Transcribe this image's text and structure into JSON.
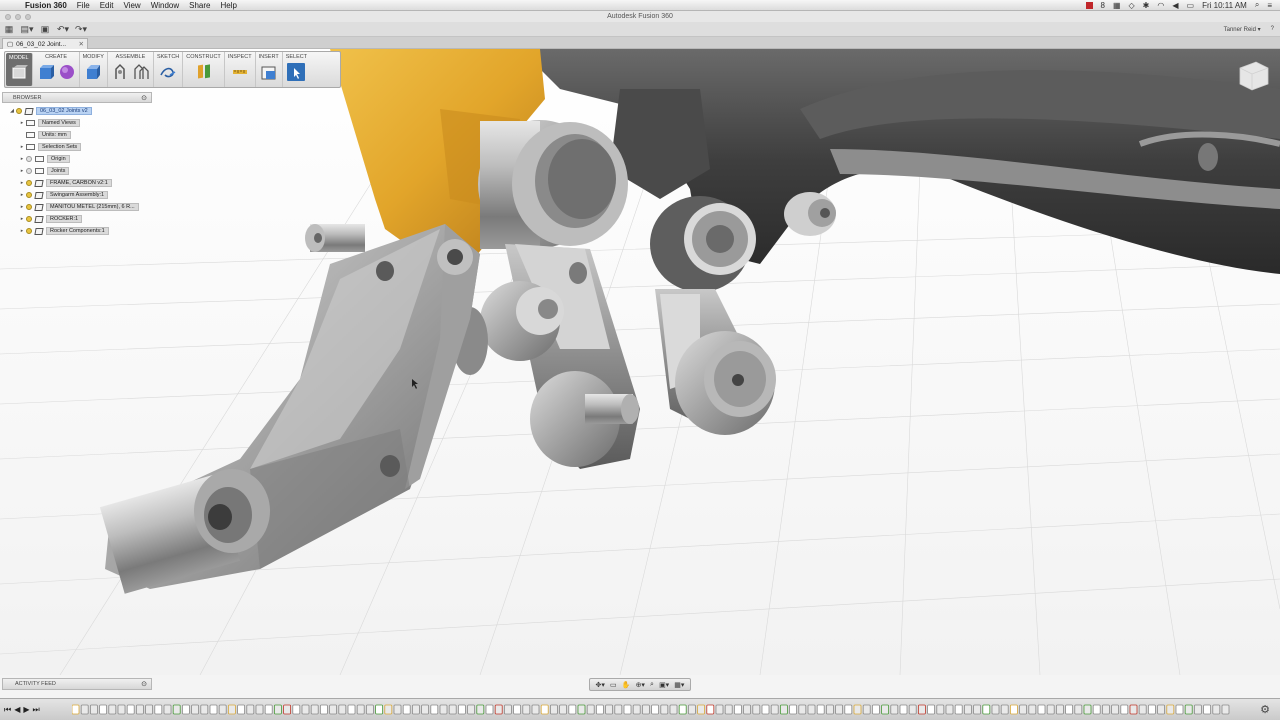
{
  "menubar": {
    "apple": "",
    "app_name": "Fusion 360",
    "items": [
      "File",
      "Edit",
      "View",
      "Window",
      "Share",
      "Help"
    ],
    "status_number": "8",
    "clock": "Fri 10:11 AM"
  },
  "window": {
    "title": "Autodesk Fusion 360"
  },
  "quick_access": {
    "user": "Tanner Reid ▾",
    "help": "?"
  },
  "document_tab": {
    "label": "06_03_02 Joint...",
    "close": "✕"
  },
  "toolbar": {
    "groups": [
      {
        "label": "MODEL"
      },
      {
        "label": "CREATE"
      },
      {
        "label": "MODIFY"
      },
      {
        "label": "ASSEMBLE"
      },
      {
        "label": "SKETCH"
      },
      {
        "label": "CONSTRUCT"
      },
      {
        "label": "INSPECT"
      },
      {
        "label": "INSERT"
      },
      {
        "label": "SELECT"
      }
    ]
  },
  "browser": {
    "header": "BROWSER",
    "items": [
      {
        "label": "06_03_02 Joints v2",
        "selected": true
      },
      {
        "label": "Named Views"
      },
      {
        "label": "Units: mm"
      },
      {
        "label": "Selection Sets"
      },
      {
        "label": "Origin"
      },
      {
        "label": "Joints"
      },
      {
        "label": "FRAME, CARBON v2:1"
      },
      {
        "label": "Swingarm Assembly:1"
      },
      {
        "label": "MANITOU METEL (215mm), 6 R..."
      },
      {
        "label": "ROCKER:1"
      },
      {
        "label": "Rocker Components:1"
      }
    ]
  },
  "activity_feed": {
    "label": "ACTIVITY FEED"
  },
  "timeline": {
    "item_count": 126
  },
  "colors": {
    "frame_orange": "#e2a52a",
    "metal": "#b5b5b5",
    "dark_swingarm": "#3e3e3e",
    "selection_blue": "#b9d2f2"
  }
}
